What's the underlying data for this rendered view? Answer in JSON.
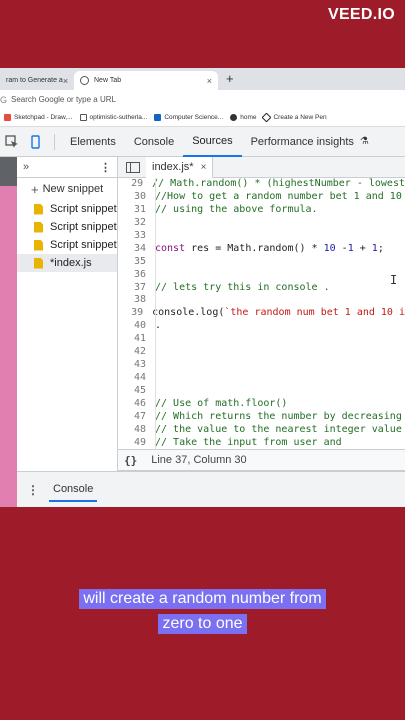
{
  "watermark": "VEED.IO",
  "browser": {
    "tabs": [
      {
        "label": "ram to Generate a"
      },
      {
        "label": "New Tab"
      }
    ],
    "new_tab_glyph": "+",
    "address_placeholder": "Search Google or type a URL",
    "bookmarks": [
      {
        "label": "Sketchpad - Draw,...",
        "color": "#e74c3c"
      },
      {
        "label": "optimistic-sutherla...",
        "color": "#555555"
      },
      {
        "label": "Computer Science...",
        "color": "#1565c0"
      },
      {
        "label": "home",
        "color": "#333333"
      },
      {
        "label": "Create a New Pen",
        "color": "#222222"
      }
    ]
  },
  "devtools": {
    "tabs": [
      "Elements",
      "Console",
      "Sources",
      "Performance insights"
    ],
    "active_tab": "Sources",
    "navigator": {
      "chevron": "»",
      "new_snippet": "New snippet",
      "snippets": [
        "Script snippet",
        "Script snippet",
        "Script snippet",
        "*index.js"
      ],
      "selected_index": 3
    },
    "editor": {
      "file_tab": "index.js*",
      "status": "Line 37, Column 30",
      "status_icon": "{}",
      "lines": [
        {
          "n": "29",
          "t": "// Math.random() * (highestNumber - lowest",
          "k": "com"
        },
        {
          "n": "30",
          "t": "//How to get a random number bet 1 and 10",
          "k": "com"
        },
        {
          "n": "31",
          "t": "// using the above formula.",
          "k": "com"
        },
        {
          "n": "32",
          "t": "",
          "k": ""
        },
        {
          "n": "33",
          "t": "",
          "k": ""
        },
        {
          "n": "34",
          "t": "const res = Math.random() * 10 -1 + 1;",
          "k": "code1"
        },
        {
          "n": "35",
          "t": "",
          "k": ""
        },
        {
          "n": "36",
          "t": "",
          "k": ""
        },
        {
          "n": "37",
          "t": "// lets try this in console .",
          "k": "com"
        },
        {
          "n": "38",
          "t": "",
          "k": ""
        },
        {
          "n": "39",
          "t": "console.log(`the random num bet 1 and 10 i",
          "k": "code2"
        },
        {
          "n": "40",
          "t": ".",
          "k": ""
        },
        {
          "n": "41",
          "t": "",
          "k": ""
        },
        {
          "n": "42",
          "t": "",
          "k": ""
        },
        {
          "n": "43",
          "t": "",
          "k": ""
        },
        {
          "n": "44",
          "t": "",
          "k": ""
        },
        {
          "n": "45",
          "t": "",
          "k": ""
        },
        {
          "n": "46",
          "t": "// Use of math.floor()",
          "k": "com"
        },
        {
          "n": "47",
          "t": "// Which returns the number by decreasing",
          "k": "com"
        },
        {
          "n": "48",
          "t": "// the value to the nearest integer value",
          "k": "com"
        },
        {
          "n": "49",
          "t": "// Take the input from user and",
          "k": "com"
        }
      ]
    },
    "drawer": {
      "tab": "Console"
    }
  },
  "captions": {
    "line1": "will create a random number from",
    "line2": "zero to one"
  }
}
